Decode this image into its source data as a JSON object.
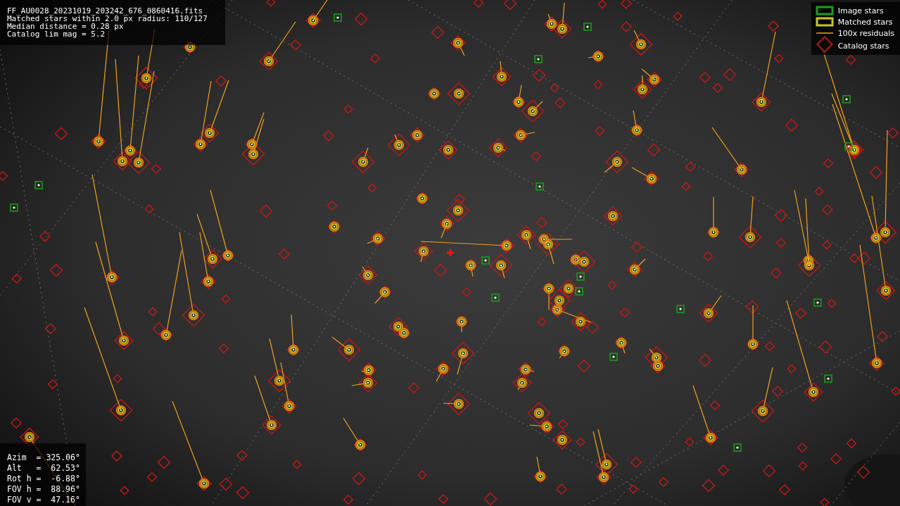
{
  "info": [
    "FF_AU0028_20231019_203242_676_0860416.fits",
    "Matched stars within 2.0 px radius: 110/127",
    "Median distance = 0.28 px",
    "Catalog lim mag = 5.2"
  ],
  "pointing": [
    "Azim  = 325.06°",
    "Alt   =  62.53°",
    "Rot h =  -6.88°",
    "FOV h =  88.96°",
    "FOV v =  47.16°"
  ],
  "legend": [
    {
      "kind": "image",
      "label": "Image stars"
    },
    {
      "kind": "matched",
      "label": "Matched stars"
    },
    {
      "kind": "residual",
      "label": "100x residuals"
    },
    {
      "kind": "catalog",
      "label": "Catalog stars"
    }
  ]
}
